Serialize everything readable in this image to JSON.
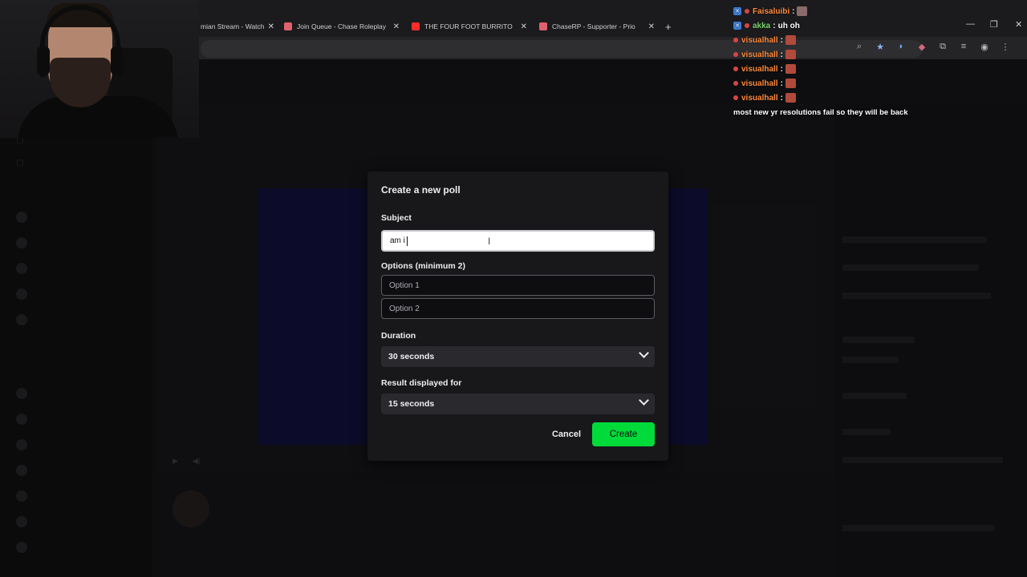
{
  "browser": {
    "tabs": [
      {
        "label": "mian Stream - Watch",
        "fav_color": "#d0d0d0"
      },
      {
        "label": "Join Queue - Chase Roleplay",
        "fav_color": "#e0606e"
      },
      {
        "label": "THE FOUR FOOT BURRITO CHA",
        "fav_color": "#ff2b2b"
      },
      {
        "label": "ChaseRP - Supporter - Prio",
        "fav_color": "#e0606e"
      }
    ],
    "new_tab": "+",
    "tab_close": "✕",
    "window_controls": [
      "—",
      "❐",
      "✕"
    ]
  },
  "overlay_chat": {
    "lines": [
      {
        "user": "Faisaluibi",
        "text": "",
        "color": "#ff8a3d",
        "badge_color": "#3a7bd5",
        "emote": true
      },
      {
        "user": "akka",
        "text": "uh oh",
        "color": "#7cd36f",
        "badge_color": "#3a7bd5",
        "emote": false
      },
      {
        "user": "visualhall",
        "text": "",
        "color": "#ff8a3d",
        "badge_color": "",
        "emote": true
      },
      {
        "user": "visualhall",
        "text": "",
        "color": "#ff8a3d",
        "badge_color": "",
        "emote": true
      },
      {
        "user": "visualhall",
        "text": "",
        "color": "#ff8a3d",
        "badge_color": "",
        "emote": true
      },
      {
        "user": "visualhall",
        "text": "",
        "color": "#ff8a3d",
        "badge_color": "",
        "emote": true
      },
      {
        "user": "visualhall",
        "text": "",
        "color": "#ff8a3d",
        "badge_color": "",
        "emote": true
      }
    ],
    "separator": " :",
    "last_message": "most new yr resolutions fail so they will be back"
  },
  "modal": {
    "title": "Create a new poll",
    "subject_label": "Subject",
    "subject_value": "am i",
    "options_label": "Options (minimum 2)",
    "option1_placeholder": "Option 1",
    "option2_placeholder": "Option 2",
    "duration_label": "Duration",
    "duration_value": "30 seconds",
    "result_label": "Result displayed for",
    "result_value": "15 seconds",
    "cancel_label": "Cancel",
    "create_label": "Create"
  },
  "colors": {
    "accent_green": "#00db3a",
    "modal_bg": "#18181b"
  }
}
